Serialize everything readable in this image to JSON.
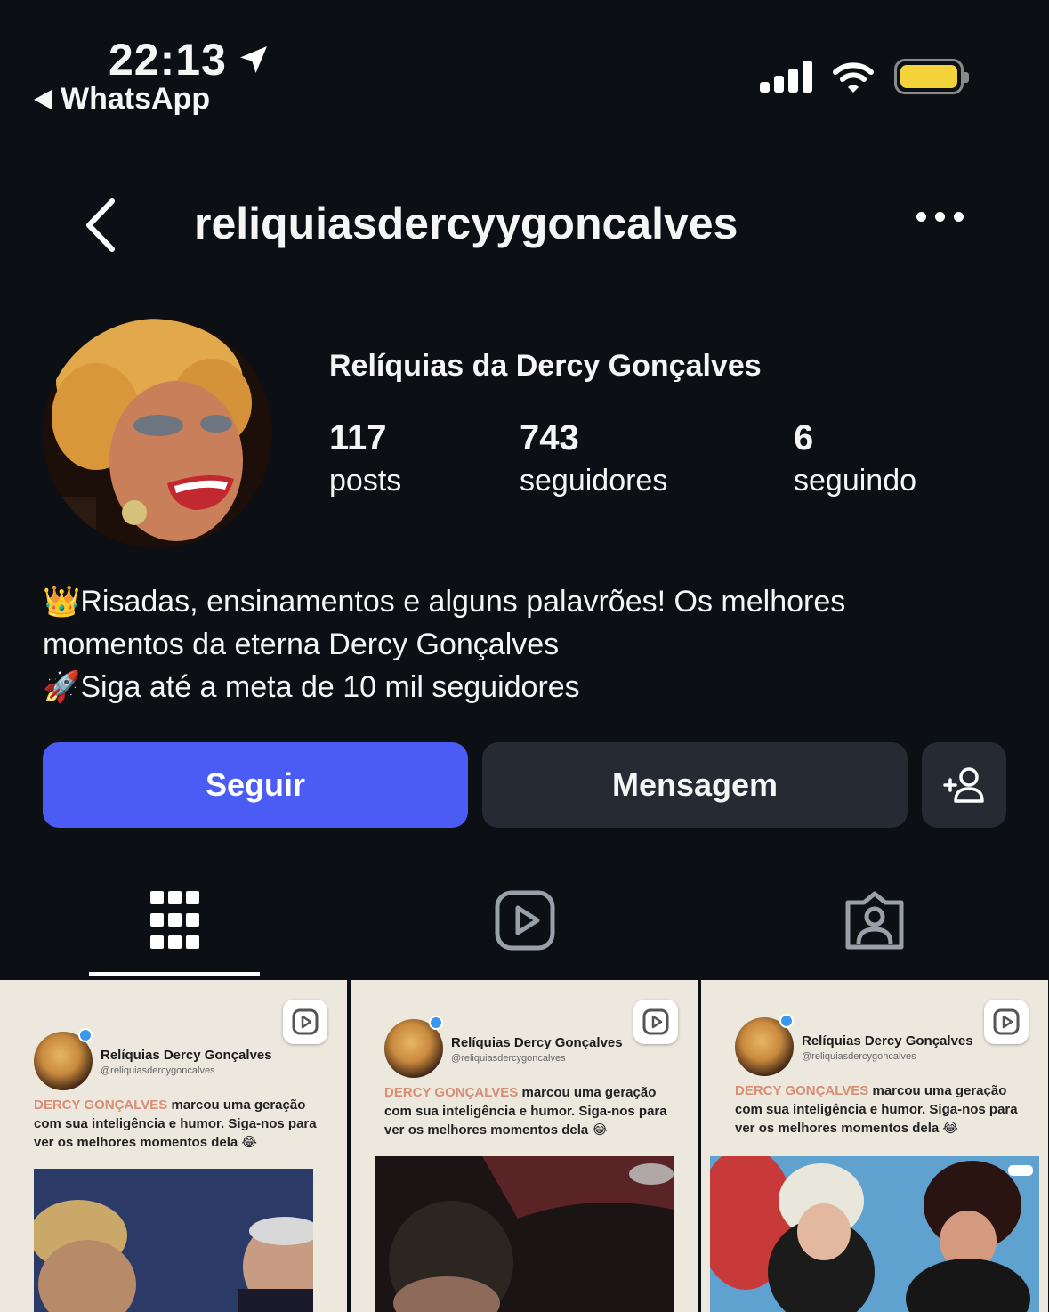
{
  "status_bar": {
    "time": "22:13",
    "back_app": "WhatsApp"
  },
  "header": {
    "username": "reliquiasdercyygoncalves"
  },
  "profile": {
    "display_name": "Relíquias da Dercy Gonçalves",
    "stats": [
      {
        "value": "117",
        "label": "posts"
      },
      {
        "value": "743",
        "label": "seguidores"
      },
      {
        "value": "6",
        "label": "seguindo"
      }
    ],
    "bio_line1": "Risadas, ensinamentos e alguns palavrões! Os melhores",
    "bio_line2": "momentos da eterna Dercy Gonçalves",
    "bio_line3": "Siga até a meta de 10 mil seguidores",
    "bio_emoji1": "👑",
    "bio_emoji2": "🚀"
  },
  "actions": {
    "follow_label": "Seguir",
    "message_label": "Mensagem"
  },
  "tabs": [
    {
      "icon": "grid-icon",
      "active": true
    },
    {
      "icon": "reels-icon",
      "active": false
    },
    {
      "icon": "tagged-icon",
      "active": false
    }
  ],
  "posts": [
    {
      "name": "Relíquias Dercy Gonçalves",
      "handle": "@reliquiasdercygoncalves",
      "highlight": "DERCY GONÇALVES",
      "text": " marcou uma geração com sua inteligência e humor. Siga-nos para ver os melhores momentos dela 😂"
    },
    {
      "name": "Relíquias Dercy Gonçalves",
      "handle": "@reliquiasdercygoncalves",
      "highlight": "DERCY GONÇALVES",
      "text": " marcou uma geração com sua inteligência e humor. Siga-nos para ver os melhores momentos dela 😂"
    },
    {
      "name": "Relíquias Dercy Gonçalves",
      "handle": "@reliquiasdercygoncalves",
      "highlight": "DERCY GONÇALVES",
      "text": " marcou uma geração com sua inteligência e humor. Siga-nos para ver os melhores momentos dela 😂"
    }
  ],
  "colors": {
    "background": "#0c0f14",
    "follow_button": "#4a5cf4",
    "secondary_button": "#262a32",
    "battery": "#f4d33a",
    "post_bg": "#ece8de",
    "highlight_text": "#d98d73"
  }
}
